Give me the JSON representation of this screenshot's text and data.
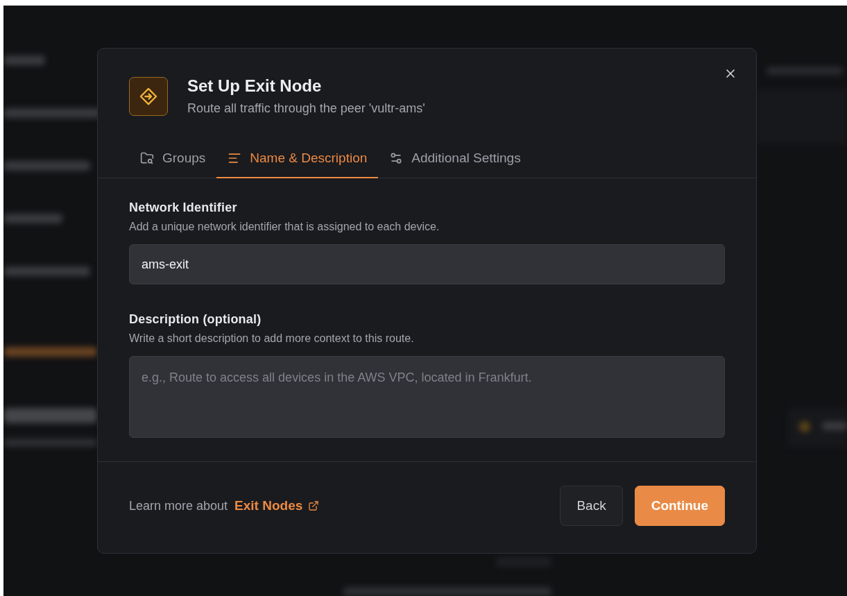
{
  "dialog": {
    "title": "Set Up Exit Node",
    "subtitle": "Route all traffic through the peer 'vultr-ams'"
  },
  "tabs": [
    {
      "label": "Groups",
      "kind": "groups",
      "selected": false
    },
    {
      "label": "Name & Description",
      "kind": "text",
      "selected": true
    },
    {
      "label": "Additional Settings",
      "kind": "settings",
      "selected": false
    }
  ],
  "fields": [
    {
      "kind": "input",
      "label": "Network Identifier",
      "help": "Add a unique network identifier that is assigned to each device.",
      "value": "ams-exit"
    },
    {
      "kind": "textarea",
      "label": "Description (optional)",
      "help": "Write a short description to add more context to this route.",
      "placeholder": "e.g., Route to access all devices in the AWS VPC, located in Frankfurt."
    }
  ],
  "footer": {
    "text": "Learn more about",
    "link": "Exit Nodes",
    "buttons": [
      {
        "label": "Back",
        "kind": "secondary"
      },
      {
        "label": "Continue",
        "kind": "primary"
      }
    ]
  }
}
